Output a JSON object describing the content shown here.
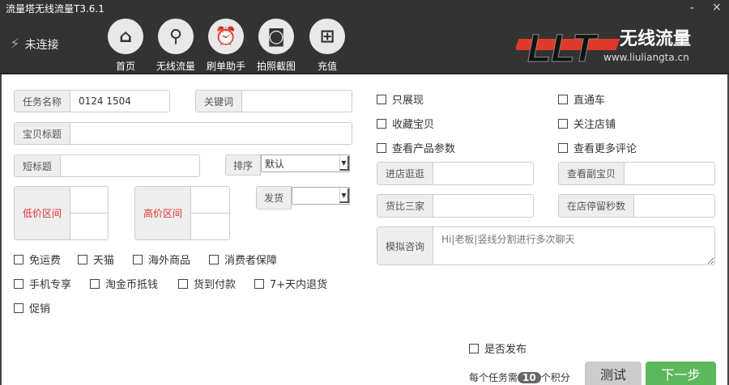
{
  "app": {
    "title": "流量塔无线流量T3.6.1",
    "minimize": "-",
    "close": "×"
  },
  "status": {
    "label": "未连接"
  },
  "nav": [
    {
      "label": "首页",
      "icon": "home-icon"
    },
    {
      "label": "无线流量",
      "icon": "search-icon"
    },
    {
      "label": "刷单助手",
      "icon": "alarm-clock-icon"
    },
    {
      "label": "拍照截图",
      "icon": "camera-icon"
    },
    {
      "label": "充值",
      "icon": "basket-icon"
    }
  ],
  "logo": {
    "mark": "LLT",
    "name": "无线流量",
    "url": "www.liuliangta.cn"
  },
  "form": {
    "task_name": {
      "label": "任务名称",
      "value": "0124 1504"
    },
    "keyword": {
      "label": "关键词",
      "value": ""
    },
    "item_title": {
      "label": "宝贝标题",
      "value": ""
    },
    "short_title": {
      "label": "短标题",
      "value": ""
    },
    "sort": {
      "label": "排序",
      "value": "默认"
    },
    "shipping": {
      "label": "发货",
      "value": ""
    },
    "low_price": {
      "label": "低价区间"
    },
    "high_price": {
      "label": "高价区间"
    },
    "checkboxes": [
      "免运费",
      "天猫",
      "海外商品",
      "消费者保障",
      "手机专享",
      "淘金币抵钱",
      "货到付款",
      "7+天内退货",
      "促销"
    ]
  },
  "right": {
    "checkboxes": [
      "只展现",
      "直通车",
      "收藏宝贝",
      "关注店铺",
      "查看产品参数",
      "查看更多评论"
    ],
    "visit_shop": {
      "label": "进店逛逛",
      "unit": "%"
    },
    "view_sub": {
      "label": "查看副宝贝",
      "unit": "%"
    },
    "compare": {
      "label": "货比三家"
    },
    "stay_seconds": {
      "label": "在店停留秒数"
    },
    "consult": {
      "label": "模拟咨询",
      "placeholder": "Hi|老板|竖线分割进行多次聊天"
    }
  },
  "footer": {
    "publish": "是否发布",
    "cost_prefix": "每个任务需",
    "cost": "10",
    "cost_suffix": "个积分",
    "test": "测试",
    "next": "下一步"
  },
  "colors": {
    "header": "#333333",
    "green": "#5cb85c",
    "red": "#e03030"
  }
}
